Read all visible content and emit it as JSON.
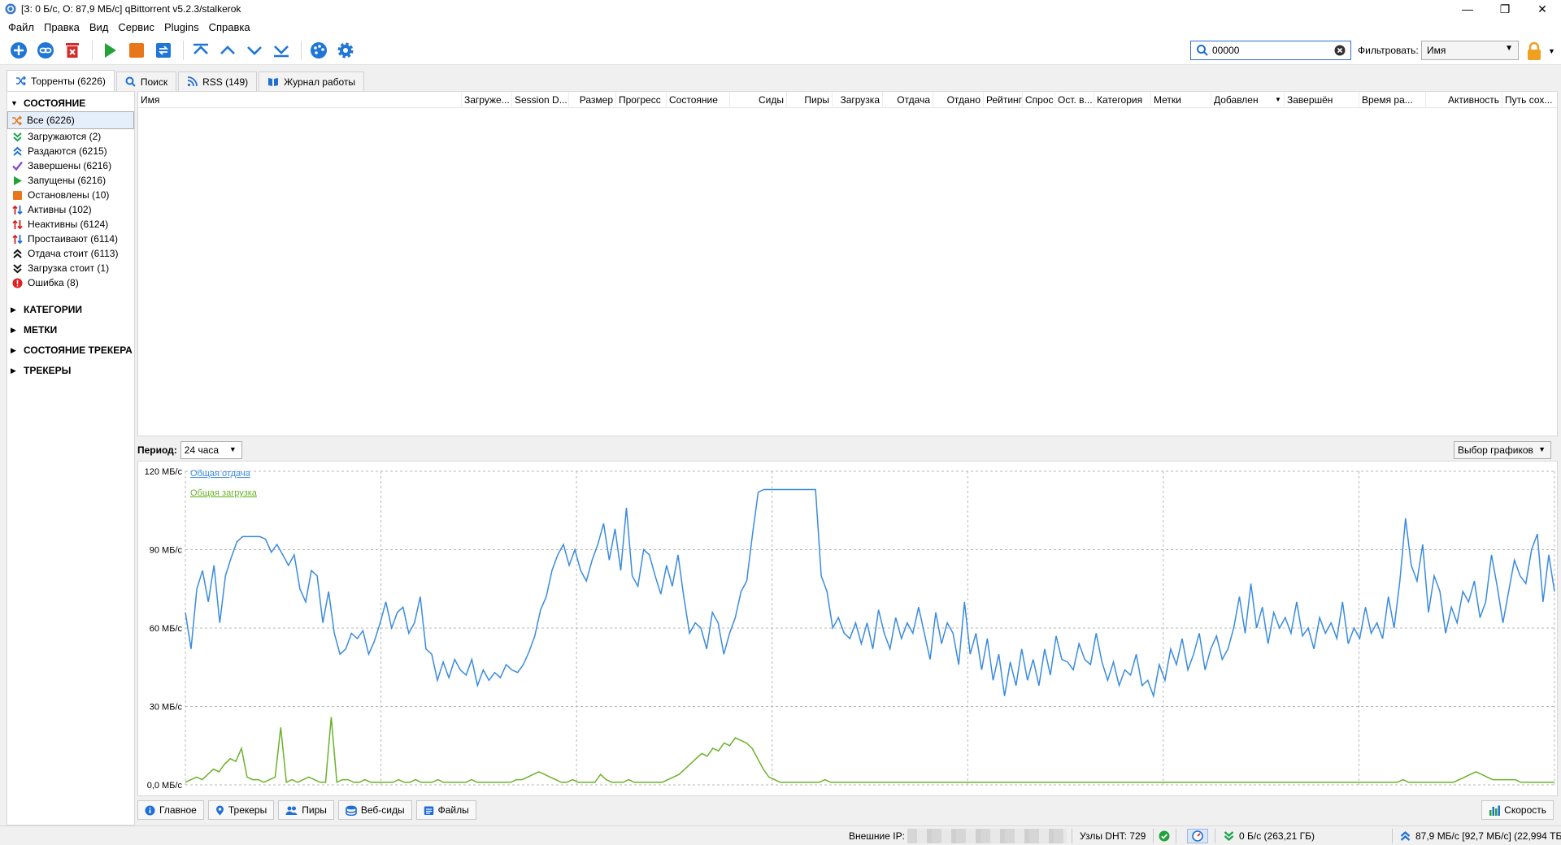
{
  "window": {
    "title": "[З: 0 Б/с, О: 87,9 МБ/с] qBittorrent v5.2.3/stalkerok",
    "minimize": "—",
    "maximize": "❐",
    "close": "✕"
  },
  "menu": [
    "Файл",
    "Правка",
    "Вид",
    "Сервис",
    "Plugins",
    "Справка"
  ],
  "search": {
    "value": "00000"
  },
  "filter": {
    "label": "Фильтровать:",
    "value": "Имя"
  },
  "tabs": [
    {
      "label": "Торренты (6226)",
      "icon": "shuffle-icon"
    },
    {
      "label": "Поиск",
      "icon": "search-icon"
    },
    {
      "label": "RSS (149)",
      "icon": "rss-icon"
    },
    {
      "label": "Журнал работы",
      "icon": "book-icon"
    }
  ],
  "sidebar": {
    "status_header": "СОСТОЯНИЕ",
    "items": [
      {
        "label": "Все (6226)",
        "icon": "shuffle-icon",
        "color": "#e8761a"
      },
      {
        "label": "Загружаются (2)",
        "icon": "download-chevrons-icon",
        "color": "#17a34a"
      },
      {
        "label": "Раздаются (6215)",
        "icon": "upload-chevrons-icon",
        "color": "#1f6fd6"
      },
      {
        "label": "Завершены (6216)",
        "icon": "checkmark-icon",
        "color": "#8d4cc9"
      },
      {
        "label": "Запущены (6216)",
        "icon": "play-icon",
        "color": "#22a33a"
      },
      {
        "label": "Остановлены (10)",
        "icon": "stop-icon",
        "color": "#e8761a"
      },
      {
        "label": "Активны (102)",
        "icon": "arrows-updown-icon",
        "color": "#1f6fd6"
      },
      {
        "label": "Неактивны (6124)",
        "icon": "arrows-updown-red-icon",
        "color": "#d62020"
      },
      {
        "label": "Простаивают (6114)",
        "icon": "arrows-updown-icon",
        "color": "#1f6fd6"
      },
      {
        "label": "Отдача стоит (6113)",
        "icon": "upload-chevrons-black-icon",
        "color": "#111111"
      },
      {
        "label": "Загрузка стоит (1)",
        "icon": "download-chevrons-black-icon",
        "color": "#111111"
      },
      {
        "label": "Ошибка (8)",
        "icon": "error-icon",
        "color": "#e02020"
      }
    ],
    "sections": [
      "КАТЕГОРИИ",
      "МЕТКИ",
      "СОСТОЯНИЕ ТРЕКЕРА",
      "ТРЕКЕРЫ"
    ]
  },
  "table": {
    "columns": [
      "Имя",
      "Загруже...",
      "Session D...",
      "Размер",
      "Прогресс",
      "Состояние",
      "Сиды",
      "Пиры",
      "Загрузка",
      "Отдача",
      "Отдано",
      "Рейтинг",
      "Спрос",
      "Ост. в...",
      "Категория",
      "Метки",
      "Добавлен",
      "Завершён",
      "Время ра...",
      "Активность",
      "Путь сох..."
    ]
  },
  "period": {
    "label": "Период:",
    "value": "24 часа",
    "charts_select": "Выбор графиков"
  },
  "chart_data": {
    "type": "line",
    "ylim": [
      0,
      120
    ],
    "ytick_labels": [
      "0,0 МБ/с",
      "30 МБ/с",
      "60 МБ/с",
      "90 МБ/с",
      "120 МБ/с"
    ],
    "yticks": [
      0,
      30,
      60,
      90,
      120
    ],
    "grid": true,
    "legend_position": "top-left",
    "series": [
      {
        "name": "Общая отдача",
        "color": "#3a8be0",
        "values": [
          66,
          52,
          75,
          82,
          70,
          84,
          62,
          80,
          87,
          93,
          95,
          95,
          95,
          95,
          94,
          89,
          92,
          88,
          84,
          88,
          75,
          70,
          82,
          80,
          62,
          74,
          58,
          50,
          52,
          58,
          56,
          59,
          50,
          55,
          62,
          70,
          60,
          66,
          68,
          58,
          62,
          72,
          52,
          50,
          40,
          47,
          41,
          48,
          44,
          42,
          48,
          38,
          44,
          40,
          43,
          41,
          46,
          44,
          43,
          46,
          51,
          57,
          67,
          72,
          82,
          88,
          92,
          84,
          90,
          82,
          78,
          86,
          92,
          100,
          86,
          98,
          82,
          106,
          80,
          76,
          90,
          88,
          80,
          73,
          84,
          76,
          88,
          72,
          58,
          62,
          60,
          52,
          66,
          62,
          50,
          58,
          64,
          74,
          78,
          96,
          112,
          113,
          113,
          113,
          113,
          113,
          113,
          113,
          113,
          113,
          113,
          80,
          74,
          60,
          64,
          58,
          56,
          62,
          54,
          62,
          52,
          67,
          58,
          52,
          64,
          56,
          62,
          58,
          68,
          58,
          48,
          66,
          54,
          62,
          58,
          46,
          70,
          50,
          58,
          44,
          56,
          40,
          50,
          34,
          47,
          38,
          52,
          40,
          48,
          38,
          52,
          42,
          57,
          48,
          47,
          44,
          54,
          48,
          46,
          58,
          47,
          40,
          47,
          38,
          44,
          42,
          50,
          38,
          40,
          34,
          46,
          40,
          52,
          46,
          56,
          44,
          50,
          58,
          44,
          52,
          57,
          48,
          52,
          60,
          72,
          58,
          77,
          60,
          68,
          54,
          66,
          60,
          64,
          58,
          70,
          57,
          60,
          52,
          64,
          58,
          62,
          56,
          70,
          54,
          60,
          56,
          68,
          58,
          62,
          56,
          72,
          60,
          78,
          102,
          84,
          78,
          92,
          66,
          80,
          74,
          58,
          68,
          62,
          74,
          70,
          78,
          64,
          70,
          88,
          76,
          62,
          74,
          86,
          80,
          77,
          90,
          96,
          70,
          88,
          74
        ]
      },
      {
        "name": "Общая загрузка",
        "color": "#6ab22a",
        "values": [
          1,
          2,
          3,
          2,
          4,
          6,
          5,
          8,
          10,
          9,
          14,
          3,
          2,
          2,
          1,
          2,
          3,
          22,
          1,
          2,
          1,
          2,
          3,
          2,
          1,
          1,
          26,
          1,
          2,
          2,
          1,
          1,
          2,
          1,
          1,
          1,
          1,
          1,
          2,
          1,
          1,
          2,
          1,
          1,
          1,
          2,
          1,
          1,
          1,
          1,
          1,
          2,
          1,
          1,
          1,
          1,
          1,
          1,
          1,
          2,
          2,
          3,
          4,
          5,
          4,
          3,
          2,
          1,
          1,
          2,
          1,
          1,
          1,
          1,
          4,
          2,
          1,
          1,
          1,
          2,
          1,
          1,
          1,
          1,
          1,
          1,
          2,
          3,
          4,
          6,
          8,
          10,
          12,
          11,
          14,
          13,
          16,
          15,
          18,
          17,
          16,
          14,
          10,
          6,
          3,
          2,
          1,
          1,
          1,
          1,
          1,
          1,
          1,
          1,
          2,
          1,
          1,
          1,
          1,
          1,
          1,
          1,
          1,
          1,
          1,
          1,
          1,
          1,
          1,
          1,
          1,
          1,
          1,
          1,
          1,
          1,
          1,
          1,
          1,
          1,
          1,
          1,
          1,
          1,
          1,
          1,
          1,
          1,
          1,
          1,
          1,
          1,
          1,
          1,
          1,
          1,
          1,
          1,
          1,
          1,
          1,
          1,
          1,
          1,
          1,
          1,
          1,
          1,
          1,
          1,
          1,
          1,
          1,
          1,
          1,
          1,
          1,
          1,
          1,
          1,
          1,
          1,
          1,
          1,
          1,
          1,
          1,
          1,
          1,
          1,
          1,
          1,
          1,
          1,
          1,
          1,
          1,
          1,
          1,
          1,
          1,
          1,
          1,
          1,
          1,
          1,
          1,
          1,
          1,
          1,
          1,
          1,
          1,
          1,
          1,
          1,
          1,
          2,
          1,
          1,
          1,
          1,
          1,
          1,
          1,
          1,
          1,
          2,
          3,
          4,
          5,
          4,
          3,
          2,
          2,
          2,
          2,
          2,
          1,
          1,
          1,
          1,
          1,
          1,
          1
        ]
      }
    ]
  },
  "bottom_tabs": [
    {
      "label": "Главное",
      "icon": "info-icon"
    },
    {
      "label": "Трекеры",
      "icon": "pin-icon"
    },
    {
      "label": "Пиры",
      "icon": "users-icon"
    },
    {
      "label": "Веб-сиды",
      "icon": "server-icon"
    },
    {
      "label": "Файлы",
      "icon": "files-icon"
    }
  ],
  "speed_button": "Скорость",
  "status": {
    "external_ip_label": "Внешние IP:",
    "dht": "Узлы DHT: 729",
    "download": "0 Б/с (263,21 ГБ)",
    "upload": "87,9 МБ/с [92,7 МБ/с] (22,994 ТБ)"
  }
}
